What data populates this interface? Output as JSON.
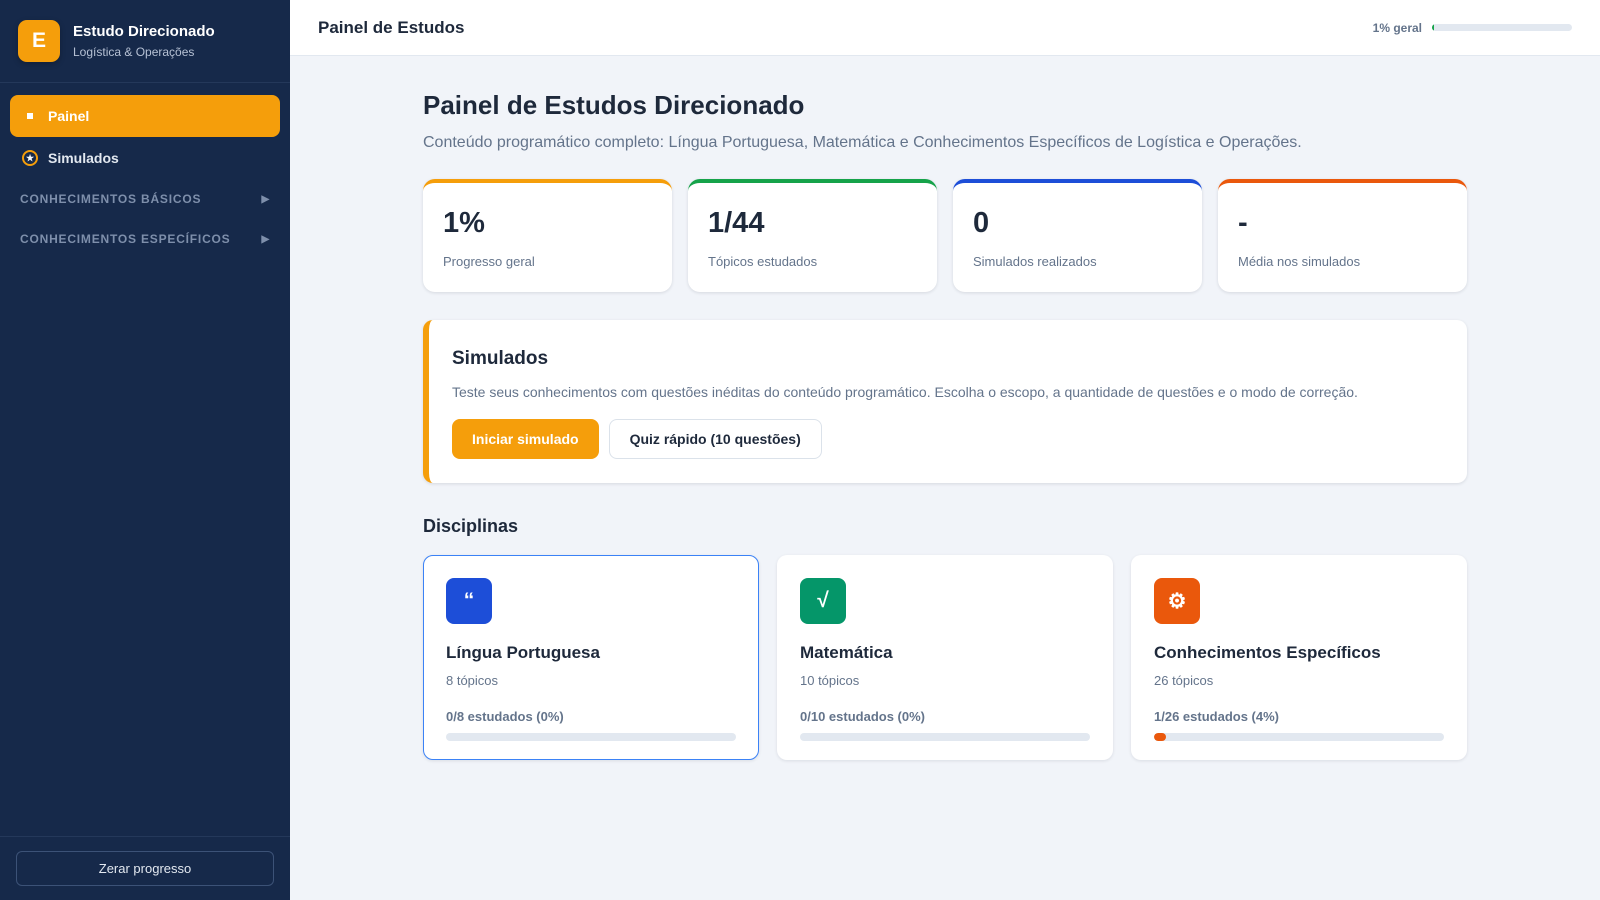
{
  "brand": {
    "logo_letter": "E",
    "title": "Estudo Direcionado",
    "subtitle": "Logística & Operações"
  },
  "sidebar": {
    "items": [
      {
        "label": "Painel",
        "icon": "square-icon",
        "active": true
      },
      {
        "label": "Simulados",
        "icon": "star-icon",
        "active": false
      }
    ],
    "sections": [
      {
        "label": "CONHECIMENTOS BÁSICOS",
        "icon": "caret-right-icon"
      },
      {
        "label": "CONHECIMENTOS ESPECÍFICOS",
        "icon": "caret-right-icon"
      }
    ],
    "reset_label": "Zerar progresso"
  },
  "topbar": {
    "title": "Painel de Estudos",
    "progress_label": "1% geral",
    "progress_fraction": 0.01,
    "progress_color": "#16a34a"
  },
  "main": {
    "title": "Painel de Estudos Direcionado",
    "subtitle": "Conteúdo programático completo: Língua Portuguesa, Matemática e Conhecimentos Específicos de Logística e Operações."
  },
  "stats": [
    {
      "value": "1%",
      "label": "Progresso geral",
      "color": "#f59e0b"
    },
    {
      "value": "1/44",
      "label": "Tópicos estudados",
      "color": "#16a34a"
    },
    {
      "value": "0",
      "label": "Simulados realizados",
      "color": "#1d4ed8"
    },
    {
      "value": "-",
      "label": "Média nos simulados",
      "color": "#ea580c"
    }
  ],
  "simulados": {
    "title": "Simulados",
    "description": "Teste seus conhecimentos com questões inéditas do conteúdo programático. Escolha o escopo, a quantidade de questões e o modo de correção.",
    "primary_label": "Iniciar simulado",
    "secondary_label": "Quiz rápido (10 questões)"
  },
  "disciplinas": {
    "title": "Disciplinas",
    "items": [
      {
        "icon_glyph": "“",
        "icon_name": "quote-icon",
        "color": "#1d4ed8",
        "name": "Língua Portuguesa",
        "topics": "8 tópicos",
        "progress_label": "0/8 estudados (0%)",
        "progress": 0,
        "selected": true
      },
      {
        "icon_glyph": "√",
        "icon_name": "sqrt-icon",
        "color": "#059669",
        "name": "Matemática",
        "topics": "10 tópicos",
        "progress_label": "0/10 estudados (0%)",
        "progress": 0,
        "selected": false
      },
      {
        "icon_glyph": "⚙",
        "icon_name": "gear-icon",
        "color": "#ea580c",
        "name": "Conhecimentos Específicos",
        "topics": "26 tópicos",
        "progress_label": "1/26 estudados (4%)",
        "progress": 0.04,
        "selected": false
      }
    ]
  }
}
